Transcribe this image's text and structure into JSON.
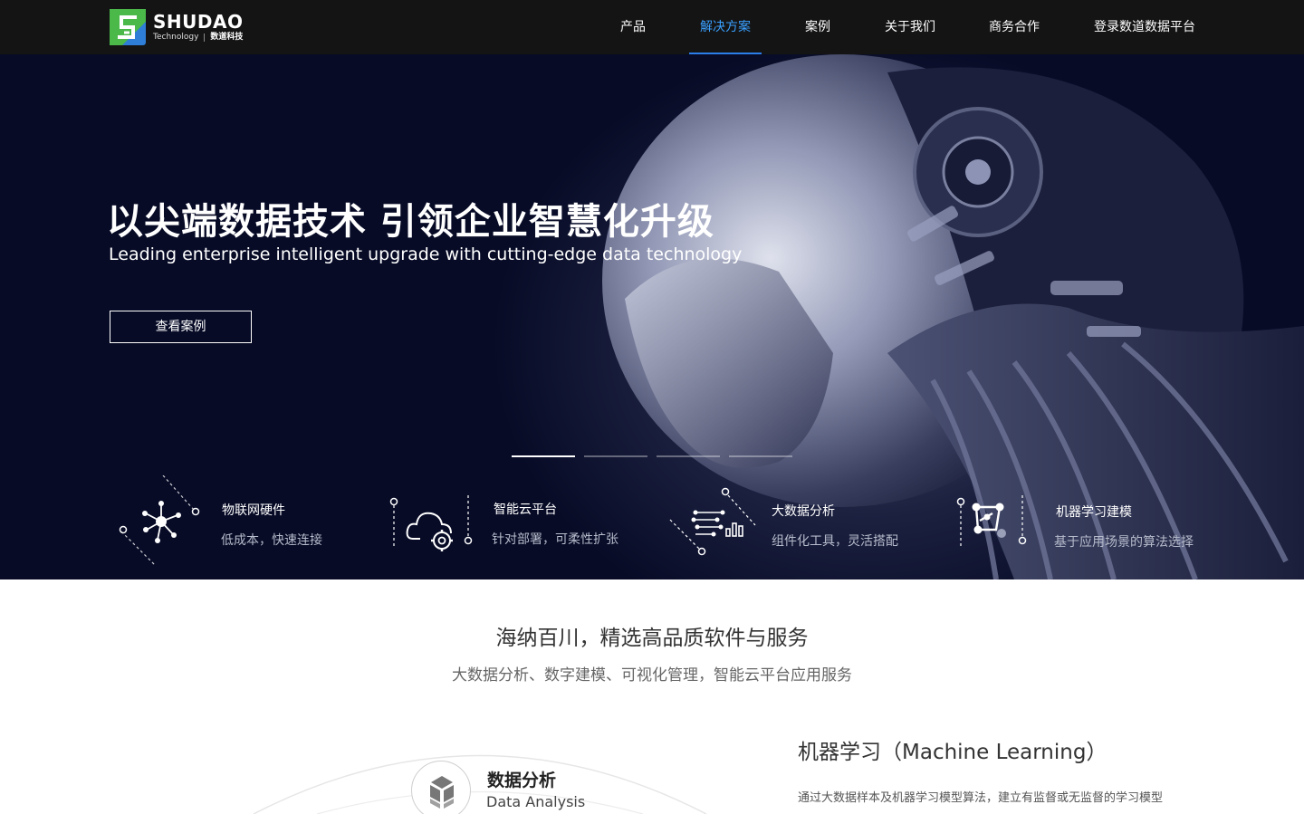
{
  "nav": {
    "logo": {
      "name": "SHUDAO",
      "sub_en": "Technology",
      "sub_cn": "数道科技"
    },
    "items": [
      {
        "label": "产品",
        "active": false
      },
      {
        "label": "解决方案",
        "active": true
      },
      {
        "label": "案例",
        "active": false
      },
      {
        "label": "关于我们",
        "active": false
      },
      {
        "label": "商务合作",
        "active": false
      },
      {
        "label": "登录数道数据平台",
        "active": false
      }
    ]
  },
  "hero": {
    "title": "以尖端数据技术  引领企业智慧化升级",
    "subtitle": "Leading enterprise intelligent upgrade with cutting-edge data technology",
    "button": "查看案例",
    "slides": 4,
    "active_slide": 1,
    "features": [
      {
        "icon": "iot-hub-icon",
        "title": "物联网硬件",
        "desc": "低成本，快速连接"
      },
      {
        "icon": "cloud-gear-icon",
        "title": "智能云平台",
        "desc": "针对部署，可柔性扩张"
      },
      {
        "icon": "data-circuit-icon",
        "title": "大数据分析",
        "desc": "组件化工具，灵活搭配"
      },
      {
        "icon": "ml-nodes-icon",
        "title": "机器学习建模",
        "desc": "基于应用场景的算法选择"
      }
    ]
  },
  "section": {
    "title": "海纳百川，精选高品质软件与服务",
    "subtitle": "大数据分析、数字建模、可视化管理，智能云平台应用服务"
  },
  "data_analysis": {
    "title": "数据分析",
    "en": "Data Analysis"
  },
  "machine_learning": {
    "title": "机器学习（Machine Learning）",
    "text": "通过大数据样本及机器学习模型算法，建立有监督或无监督的学习模型"
  },
  "colors": {
    "nav_bg": "#141414",
    "accent": "#3aa0ff",
    "hero_bg": "#070b26"
  }
}
